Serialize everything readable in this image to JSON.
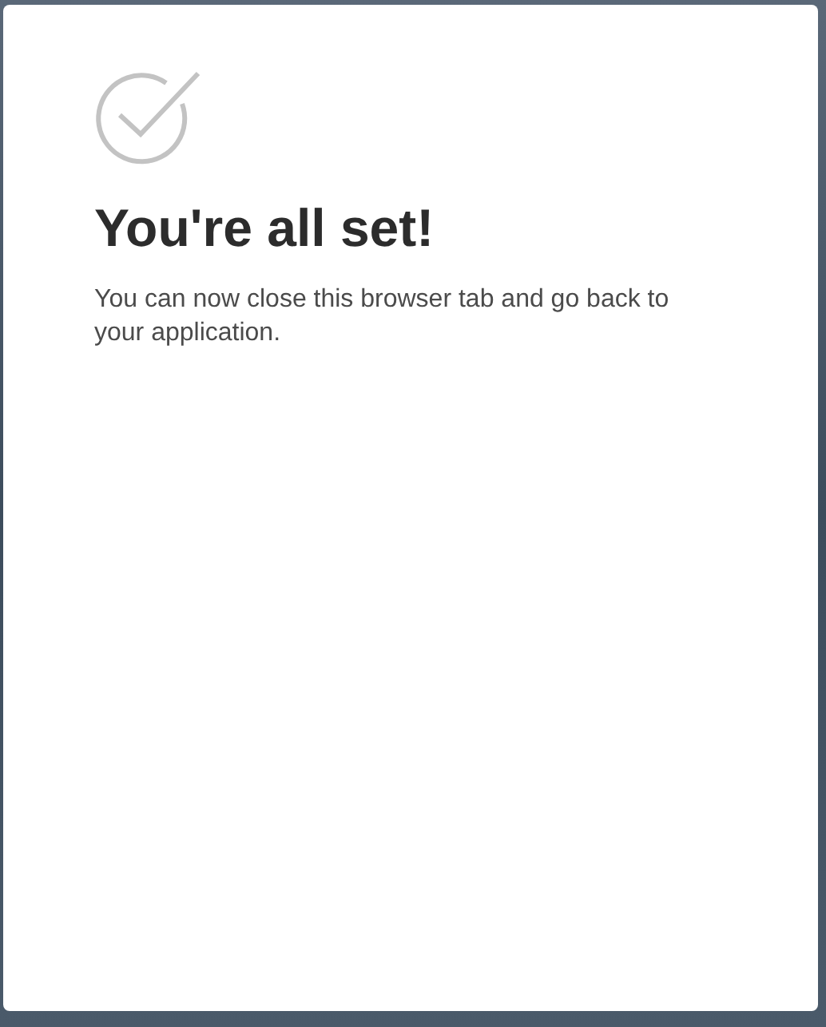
{
  "card": {
    "title": "You're all set!",
    "message": "You can now close this browser tab and go back to your application."
  }
}
